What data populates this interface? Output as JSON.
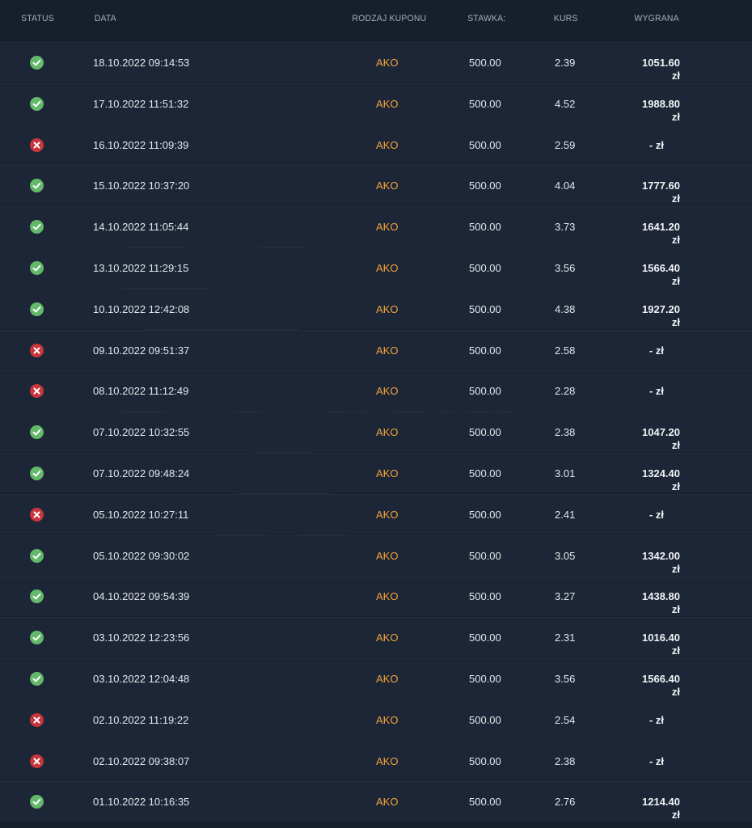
{
  "header": {
    "status": "STATUS",
    "date": "DATA",
    "type": "RODZAJ KUPONU",
    "stake": "STAWKA:",
    "odds": "KURS",
    "winnings": "WYGRANA"
  },
  "rows": [
    {
      "status": "win",
      "date": "18.10.2022 09:14:53",
      "type": "AKO",
      "stake": "500.00",
      "odds": "2.39",
      "winnings": "1051.60 zł"
    },
    {
      "status": "win",
      "date": "17.10.2022 11:51:32",
      "type": "AKO",
      "stake": "500.00",
      "odds": "4.52",
      "winnings": "1988.80 zł"
    },
    {
      "status": "loss",
      "date": "16.10.2022 11:09:39",
      "type": "AKO",
      "stake": "500.00",
      "odds": "2.59",
      "winnings": "- zł"
    },
    {
      "status": "win",
      "date": "15.10.2022 10:37:20",
      "type": "AKO",
      "stake": "500.00",
      "odds": "4.04",
      "winnings": "1777.60 zł"
    },
    {
      "status": "win",
      "date": "14.10.2022 11:05:44",
      "type": "AKO",
      "stake": "500.00",
      "odds": "3.73",
      "winnings": "1641.20 zł"
    },
    {
      "status": "win",
      "date": "13.10.2022 11:29:15",
      "type": "AKO",
      "stake": "500.00",
      "odds": "3.56",
      "winnings": "1566.40 zł"
    },
    {
      "status": "win",
      "date": "10.10.2022 12:42:08",
      "type": "AKO",
      "stake": "500.00",
      "odds": "4.38",
      "winnings": "1927.20 zł"
    },
    {
      "status": "loss",
      "date": "09.10.2022 09:51:37",
      "type": "AKO",
      "stake": "500.00",
      "odds": "2.58",
      "winnings": "- zł"
    },
    {
      "status": "loss",
      "date": "08.10.2022 11:12:49",
      "type": "AKO",
      "stake": "500.00",
      "odds": "2.28",
      "winnings": "- zł"
    },
    {
      "status": "win",
      "date": "07.10.2022 10:32:55",
      "type": "AKO",
      "stake": "500.00",
      "odds": "2.38",
      "winnings": "1047.20 zł"
    },
    {
      "status": "win",
      "date": "07.10.2022 09:48:24",
      "type": "AKO",
      "stake": "500.00",
      "odds": "3.01",
      "winnings": "1324.40 zł"
    },
    {
      "status": "loss",
      "date": "05.10.2022 10:27:11",
      "type": "AKO",
      "stake": "500.00",
      "odds": "2.41",
      "winnings": "- zł"
    },
    {
      "status": "win",
      "date": "05.10.2022 09:30:02",
      "type": "AKO",
      "stake": "500.00",
      "odds": "3.05",
      "winnings": "1342.00 zł"
    },
    {
      "status": "win",
      "date": "04.10.2022 09:54:39",
      "type": "AKO",
      "stake": "500.00",
      "odds": "3.27",
      "winnings": "1438.80 zł"
    },
    {
      "status": "win",
      "date": "03.10.2022 12:23:56",
      "type": "AKO",
      "stake": "500.00",
      "odds": "2.31",
      "winnings": "1016.40 zł"
    },
    {
      "status": "win",
      "date": "03.10.2022 12:04:48",
      "type": "AKO",
      "stake": "500.00",
      "odds": "3.56",
      "winnings": "1566.40 zł"
    },
    {
      "status": "loss",
      "date": "02.10.2022 11:19:22",
      "type": "AKO",
      "stake": "500.00",
      "odds": "2.54",
      "winnings": "- zł"
    },
    {
      "status": "loss",
      "date": "02.10.2022 09:38:07",
      "type": "AKO",
      "stake": "500.00",
      "odds": "2.38",
      "winnings": "- zł"
    },
    {
      "status": "win",
      "date": "01.10.2022 10:16:35",
      "type": "AKO",
      "stake": "500.00",
      "odds": "2.76",
      "winnings": "1214.40 zł"
    }
  ],
  "watermark_text": [
    "trefa",
    "naliz"
  ],
  "colors": {
    "background": "#171f2c",
    "row": "#1d2636",
    "accent": "#f2a33a",
    "win": "#63b86a",
    "loss": "#c8353c"
  }
}
